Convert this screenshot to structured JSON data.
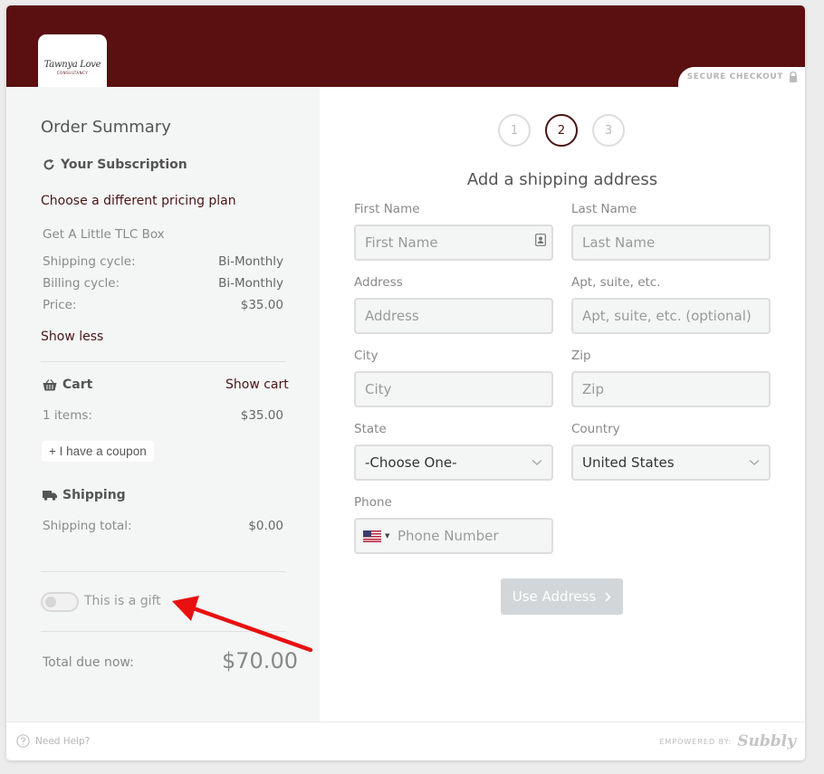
{
  "header": {
    "secure_label": "SECURE CHECKOUT",
    "logo_script": "Tawnya Love",
    "logo_sub": "CONSULTANCY",
    "bg_color": "#5a1010"
  },
  "sidebar": {
    "title": "Order Summary",
    "subscription": {
      "heading": "Your Subscription",
      "change_plan": "Choose a different pricing plan",
      "product": "Get A Little TLC Box",
      "rows": [
        {
          "label": "Shipping cycle:",
          "value": "Bi-Monthly"
        },
        {
          "label": "Billing cycle:",
          "value": "Bi-Monthly"
        },
        {
          "label": "Price:",
          "value": "$35.00"
        }
      ],
      "show_less": "Show less"
    },
    "cart": {
      "heading": "Cart",
      "show_cart": "Show cart",
      "items_label": "1 items:",
      "items_value": "$35.00",
      "coupon": "+ I have a coupon"
    },
    "shipping": {
      "heading": "Shipping",
      "total_label": "Shipping total:",
      "total_value": "$0.00"
    },
    "gift_label": "This is a gift",
    "total_label": "Total due now:",
    "total_value": "$70.00"
  },
  "main": {
    "steps": [
      "1",
      "2",
      "3"
    ],
    "active_step": "2",
    "title": "Add a shipping address",
    "fields": {
      "first_name": {
        "label": "First Name",
        "placeholder": "First Name"
      },
      "last_name": {
        "label": "Last Name",
        "placeholder": "Last Name"
      },
      "address": {
        "label": "Address",
        "placeholder": "Address"
      },
      "apt": {
        "label": "Apt, suite, etc.",
        "placeholder": "Apt, suite, etc. (optional)"
      },
      "city": {
        "label": "City",
        "placeholder": "City"
      },
      "zip": {
        "label": "Zip",
        "placeholder": "Zip"
      },
      "state": {
        "label": "State",
        "value": "-Choose One-"
      },
      "country": {
        "label": "Country",
        "value": "United States"
      },
      "phone": {
        "label": "Phone",
        "placeholder": "Phone Number"
      }
    },
    "submit": "Use Address"
  },
  "footer": {
    "help": "Need Help?",
    "powered": "EMPOWERED BY:",
    "brand": "Subbly"
  }
}
